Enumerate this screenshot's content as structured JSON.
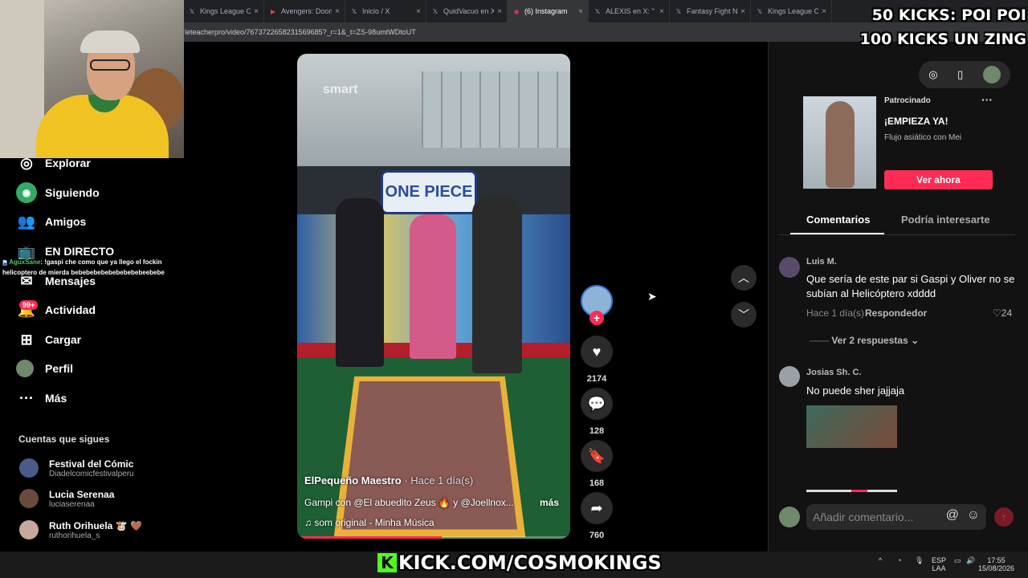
{
  "browser": {
    "tabs": [
      {
        "label": "Kings League Op",
        "icon": "x-icon"
      },
      {
        "label": "Avengers: Doom",
        "icon": "video-icon"
      },
      {
        "label": "Inicio / X",
        "icon": "x-icon"
      },
      {
        "label": "QuidVacuo en X",
        "icon": "x-icon"
      },
      {
        "label": "(6) Instagram",
        "icon": "instagram-icon"
      },
      {
        "label": "ALEXIS en X: \"",
        "icon": "x-icon"
      },
      {
        "label": "Fantasy Fight Ni",
        "icon": "x-icon"
      },
      {
        "label": "Kings League Op",
        "icon": "x-icon"
      }
    ],
    "active_tab_index": 4,
    "url": "leteacherpro/video/7673722658231569685?_r=1&_t=ZS-98umtWDtoUT"
  },
  "nav": {
    "items": [
      {
        "label": "Explorar",
        "icon": "compass-icon"
      },
      {
        "label": "Siguiendo",
        "icon": "following-icon"
      },
      {
        "label": "Amigos",
        "icon": "friends-icon"
      },
      {
        "label": "EN DIRECTO",
        "icon": "live-icon"
      },
      {
        "label": "Mensajes",
        "icon": "messages-icon"
      },
      {
        "label": "Actividad",
        "icon": "activity-icon"
      },
      {
        "label": "Cargar",
        "icon": "upload-icon"
      },
      {
        "label": "Perfil",
        "icon": "profile-icon"
      },
      {
        "label": "Más",
        "icon": "more-icon"
      }
    ],
    "activity_badge": "99+",
    "following_title": "Cuentas que sigues",
    "following": [
      {
        "name": "Festival del Cómic",
        "handle": "Diadelcomicfestivalperu",
        "color": "#4a5a8a"
      },
      {
        "name": "Lucia Serenaa",
        "handle": "luciaserenaa",
        "color": "#6a4a3a"
      },
      {
        "name": "Ruth Orihuela 🐮 🤎",
        "handle": "ruthorihuela_s",
        "color": "#c8a89a"
      }
    ]
  },
  "chat": {
    "user": "AguxSane",
    "message": "!gaspi che como que ya llego el fockin helicoptero de mierda bebebebebebebebebebeebebe"
  },
  "video": {
    "sign_text": "smart",
    "logo_text": "ONE PIECE",
    "author": "ElPequeño Maestro",
    "posted": "· Hace 1 día(s)",
    "caption": "Gampi con @El abuedito Zeus 🔥 y @Joellnox...",
    "caption_more": "más",
    "music": "som original - Minha Música",
    "progress": 0.53
  },
  "actions": {
    "likes": "2174",
    "comments": "128",
    "saves": "168",
    "shares": "760"
  },
  "ad": {
    "sponsored": "Patrocinado",
    "title": "¡EMPIEZA YA!",
    "subtitle": "Flujo asiático con Mei",
    "button": "Ver ahora"
  },
  "panel": {
    "tab_comments": "Comentarios",
    "tab_interest": "Podría interesarte",
    "comments": [
      {
        "user": "Luis M.",
        "text": "Que sería de este par si Gaspi y Oliver no se subían al Helicóptero xdddd",
        "time": "Hace 1 día(s)",
        "reply": "Respondedor",
        "likes": "24",
        "more_replies": "Ver 2 respuestas"
      },
      {
        "user": "Josias Sh. C.",
        "text": "No puede sher jajjaja"
      }
    ],
    "composer_placeholder": "Añadir comentario..."
  },
  "overlay": {
    "line1": "50 KICKS: POI POI",
    "line2": "100 KICKS UN ZING",
    "kick_letter": "K",
    "kick_url": "KICK.COM/COSMOKINGS"
  },
  "taskbar": {
    "lang1": "ESP",
    "lang2": "LAA",
    "time": "17:55",
    "date": "15/08/2026"
  },
  "colors": {
    "accent": "#fe2c55",
    "kick_green": "#53fc18",
    "panel_bg": "#121212"
  }
}
